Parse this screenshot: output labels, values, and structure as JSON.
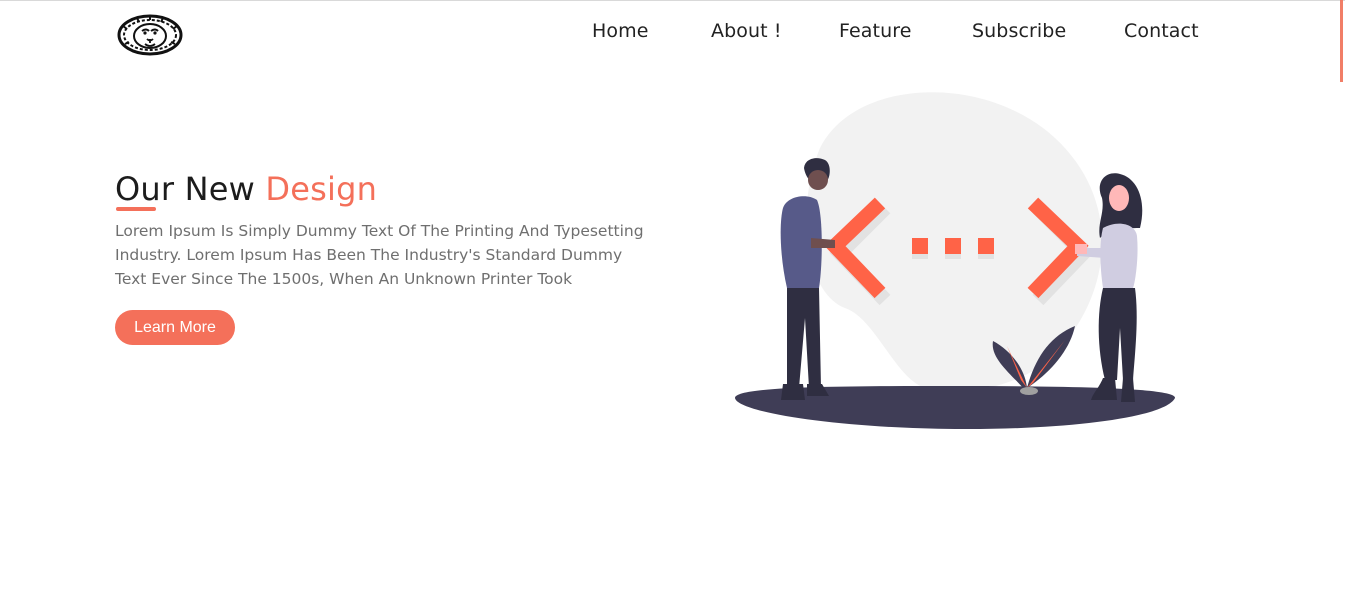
{
  "nav": {
    "items": [
      {
        "label": "Home"
      },
      {
        "label": "About !"
      },
      {
        "label": "Feature"
      },
      {
        "label": "Subscribe"
      },
      {
        "label": "Contact"
      }
    ]
  },
  "hero": {
    "title_part1": "Our New ",
    "title_part2": "Design",
    "description": "Lorem Ipsum Is Simply Dummy Text Of The Printing And Typesetting Industry. Lorem Ipsum Has Been The Industry's Standard Dummy Text Ever Since The 1500s, When An Unknown Printer Took",
    "button_label": "Learn More"
  },
  "icons": {
    "logo": "lion-logo-icon",
    "illustration": "code-collaboration-illustration"
  },
  "colors": {
    "accent": "#f4705a",
    "text_dark": "#1c1c1c",
    "text_muted": "#6f6f6f",
    "illustration_dark": "#3f3d56",
    "blob": "#f2f2f2"
  }
}
